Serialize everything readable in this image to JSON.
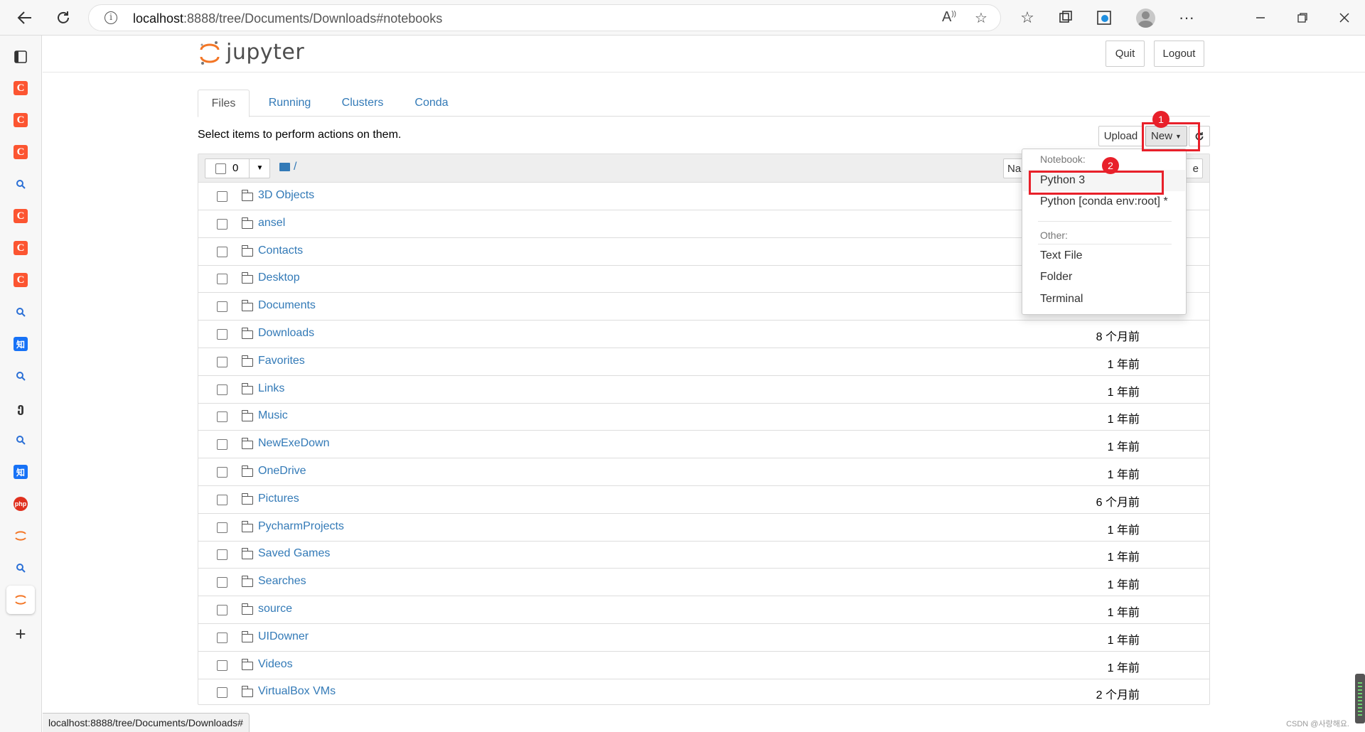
{
  "browser": {
    "url_host": "localhost",
    "url_path": ":8888/tree/Documents/Downloads#notebooks",
    "status_url": "localhost:8888/tree/Documents/Downloads#"
  },
  "sidebar": {
    "items": [
      {
        "icon": "layout-icon"
      },
      {
        "icon": "csdn-icon",
        "label": "C"
      },
      {
        "icon": "csdn-icon",
        "label": "C"
      },
      {
        "icon": "csdn-icon",
        "label": "C"
      },
      {
        "icon": "search-icon"
      },
      {
        "icon": "csdn-icon",
        "label": "C"
      },
      {
        "icon": "csdn-icon",
        "label": "C"
      },
      {
        "icon": "csdn-icon",
        "label": "C"
      },
      {
        "icon": "search-icon"
      },
      {
        "icon": "zhihu-icon",
        "label": "知"
      },
      {
        "icon": "search-icon"
      },
      {
        "icon": "script-icon"
      },
      {
        "icon": "search-icon"
      },
      {
        "icon": "zhihu-icon",
        "label": "知"
      },
      {
        "icon": "php-icon",
        "label": "php"
      },
      {
        "icon": "jupyter-icon"
      },
      {
        "icon": "search-icon"
      },
      {
        "icon": "jupyter-icon"
      },
      {
        "icon": "add-icon"
      }
    ]
  },
  "jupyter": {
    "logo_text": "jupyter",
    "quit_label": "Quit",
    "logout_label": "Logout",
    "tabs": [
      "Files",
      "Running",
      "Clusters",
      "Conda"
    ],
    "hint": "Select items to perform actions on them.",
    "upload_label": "Upload",
    "new_label": "New",
    "selected_count": "0",
    "breadcrumb_root": "/",
    "header_name_partial": "Na",
    "header_size_partial": "e",
    "files": [
      {
        "name": "3D Objects",
        "modified": ""
      },
      {
        "name": "ansel",
        "modified": ""
      },
      {
        "name": "Contacts",
        "modified": ""
      },
      {
        "name": "Desktop",
        "modified": ""
      },
      {
        "name": "Documents",
        "modified": ""
      },
      {
        "name": "Downloads",
        "modified": "8 个月前"
      },
      {
        "name": "Favorites",
        "modified": "1 年前"
      },
      {
        "name": "Links",
        "modified": "1 年前"
      },
      {
        "name": "Music",
        "modified": "1 年前"
      },
      {
        "name": "NewExeDown",
        "modified": "1 年前"
      },
      {
        "name": "OneDrive",
        "modified": "1 年前"
      },
      {
        "name": "Pictures",
        "modified": "6 个月前"
      },
      {
        "name": "PycharmProjects",
        "modified": "1 年前"
      },
      {
        "name": "Saved Games",
        "modified": "1 年前"
      },
      {
        "name": "Searches",
        "modified": "1 年前"
      },
      {
        "name": "source",
        "modified": "1 年前"
      },
      {
        "name": "UIDowner",
        "modified": "1 年前"
      },
      {
        "name": "Videos",
        "modified": "1 年前"
      },
      {
        "name": "VirtualBox VMs",
        "modified": "2 个月前"
      }
    ],
    "new_menu": {
      "notebook_header": "Notebook:",
      "notebook_items": [
        "Python 3",
        "Python [conda env:root] *"
      ],
      "other_header": "Other:",
      "other_items": [
        "Text File",
        "Folder",
        "Terminal"
      ]
    }
  },
  "annotations": {
    "badge1": "1",
    "badge2": "2"
  },
  "watermark": "CSDN @사랑해요.",
  "colors": {
    "link": "#337ab7",
    "accent_red": "#e8202a",
    "jupyter_orange": "#f37626"
  }
}
